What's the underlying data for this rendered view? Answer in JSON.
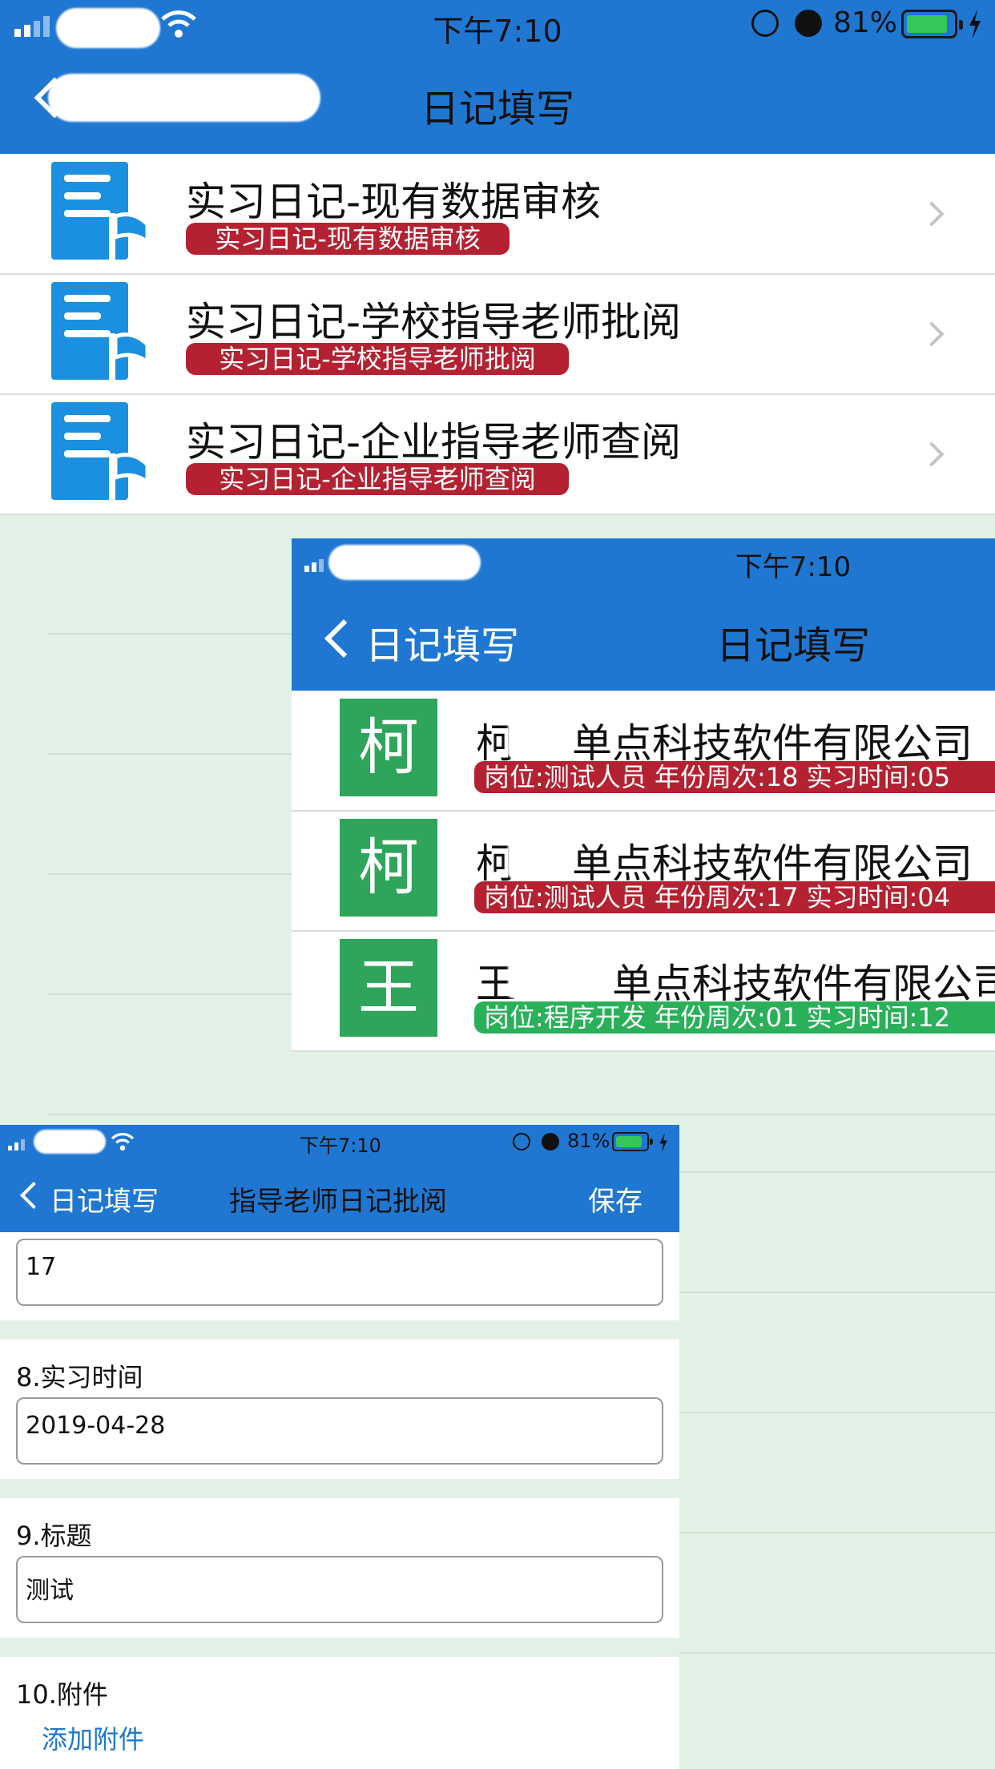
{
  "screen1": {
    "status_time": "下午7:10",
    "status_battery": "81%",
    "nav_title": "日记填写",
    "items": [
      {
        "title": "实习日记-现有数据审核",
        "subtitle": "实习日记-现有数据审核"
      },
      {
        "title": "实习日记-学校指导老师批阅",
        "subtitle": "实习日记-学校指导老师批阅"
      },
      {
        "title": "实习日记-企业指导老师查阅",
        "subtitle": "实习日记-企业指导老师查阅"
      }
    ]
  },
  "screen2": {
    "status_time": "下午7:10",
    "back_label": "日记填写",
    "nav_title": "日记填写",
    "items": [
      {
        "avatar": "柯",
        "name_start": "柯",
        "company": "单点科技软件有限公司",
        "detail": "岗位:测试人员 年份周次:18 实习时间:05",
        "status_color": "#b42232"
      },
      {
        "avatar": "柯",
        "name_start": "柯",
        "company": "单点科技软件有限公司",
        "detail": "岗位:测试人员 年份周次:17 实习时间:04",
        "status_color": "#b42232"
      },
      {
        "avatar": "王",
        "name_start": "王",
        "company": "单点科技软件有限公司",
        "detail": "岗位:程序开发 年份周次:01 实习时间:12",
        "status_color": "#2bb05a"
      }
    ]
  },
  "screen3": {
    "status_time": "下午7:10",
    "status_battery": "81%",
    "back_label": "日记填写",
    "nav_title": "指导老师日记批阅",
    "save_label": "保存",
    "week_value": "17",
    "fields": {
      "time_label": "8.实习时间",
      "time_value": "2019-04-28",
      "title_label": "9.标题",
      "title_value": "测试",
      "attach_label": "10.附件",
      "attach_link": "添加附件"
    }
  },
  "colors": {
    "nav_blue": "#1f77d2",
    "badge_red": "#b42232",
    "badge_green": "#2bb05a",
    "avatar_green": "#2ea55a",
    "page_bg": "#e2f1e6"
  }
}
